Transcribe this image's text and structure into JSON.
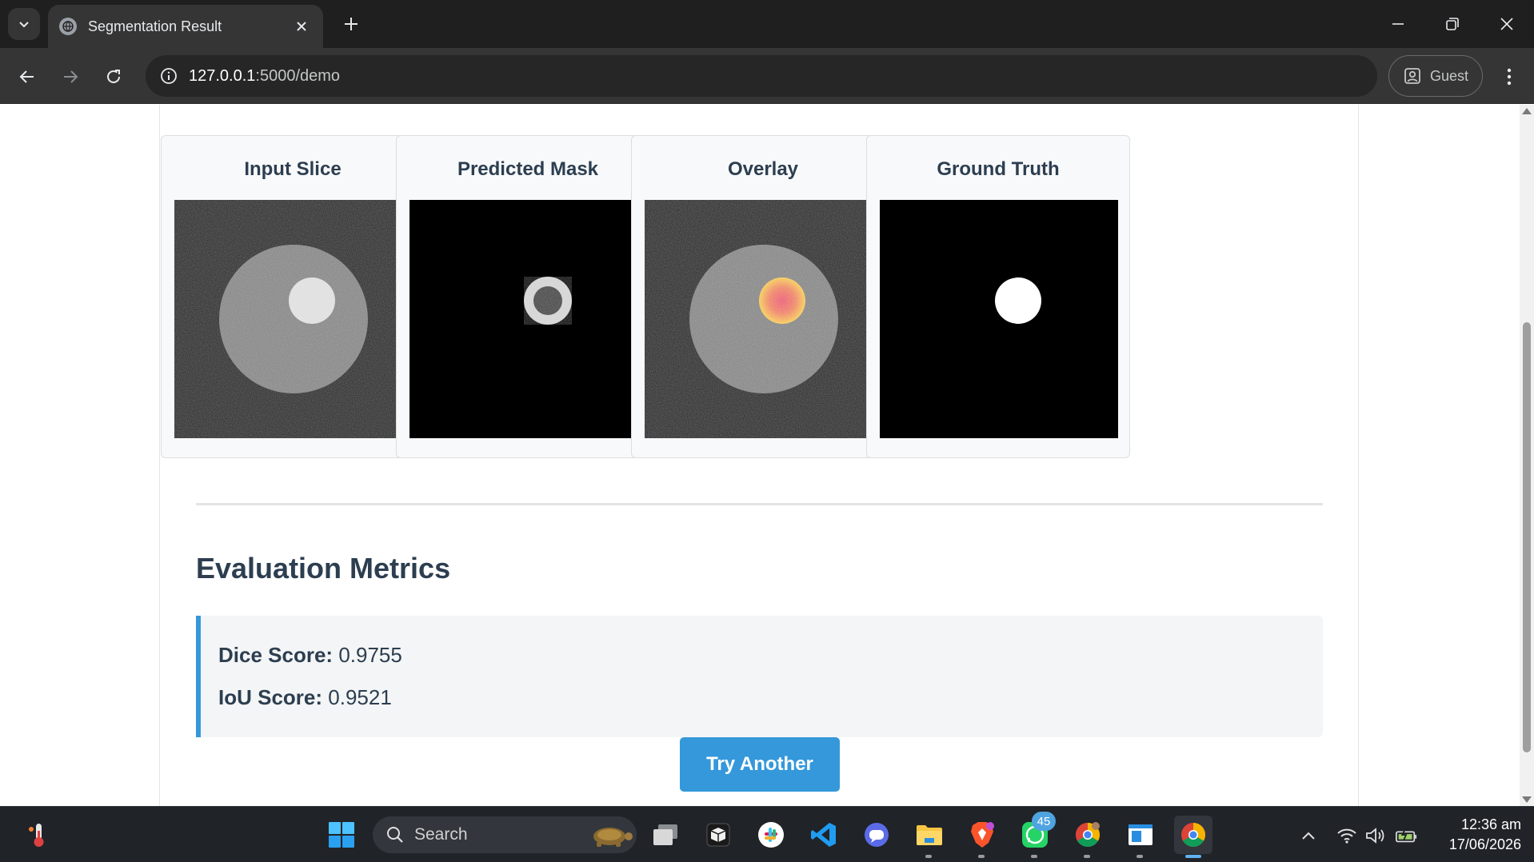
{
  "browser": {
    "tab_title": "Segmentation Result",
    "url_host": "127.0.0.1",
    "url_path": ":5000/demo",
    "profile_label": "Guest"
  },
  "panels": [
    {
      "title": "Input Slice"
    },
    {
      "title": "Predicted Mask"
    },
    {
      "title": "Overlay"
    },
    {
      "title": "Ground Truth"
    }
  ],
  "metrics": {
    "heading": "Evaluation Metrics",
    "dice_label": "Dice Score:",
    "dice_value": "0.9755",
    "iou_label": "IoU Score:",
    "iou_value": "0.9521"
  },
  "actions": {
    "try_another_label": "Try Another"
  },
  "taskbar": {
    "search_label": "Search",
    "whatsapp_badge": "45",
    "time": "12:36 am",
    "date": "17/06/2026"
  },
  "colors": {
    "accent": "#3498db",
    "heading": "#2c3e50",
    "chrome_dark": "#1f1f1f",
    "chrome_mid": "#353535"
  },
  "icons": [
    "tab-search-icon",
    "close-icon",
    "plus-icon",
    "minimize-icon",
    "restore-icon",
    "back-icon",
    "forward-icon",
    "reload-icon",
    "info-icon",
    "profile-icon",
    "kebab-icon",
    "windows-start-icon",
    "search-icon",
    "task-view-icon",
    "slack-icon",
    "vscode-icon",
    "files-icon",
    "brave-icon",
    "whatsapp-icon",
    "chrome-icon",
    "wifi-icon",
    "volume-icon",
    "battery-icon",
    "chevron-up-icon"
  ]
}
